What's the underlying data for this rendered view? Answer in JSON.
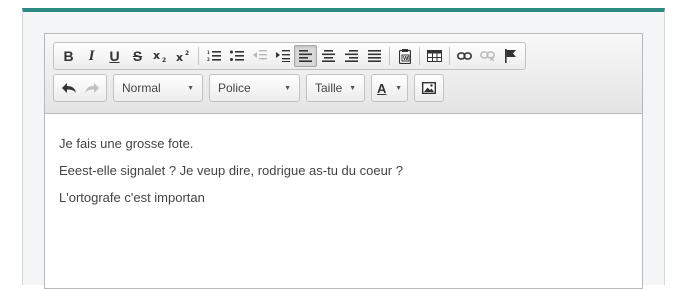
{
  "toolbar": {
    "buttons": {
      "bold": "B",
      "italic": "I",
      "underline": "U",
      "strike": "S"
    },
    "format_select": "Normal",
    "font_select": "Police",
    "size_select": "Taille",
    "text_color_label": "A",
    "active_alignment": "align-left",
    "colors": {
      "accent": "#2e8b84",
      "text": "#444444"
    }
  },
  "content": {
    "lines": [
      "Je fais une grosse fote.",
      "Eeest-elle signalet ? Je veup dire, rodrigue as-tu du coeur ?",
      "L'ortografe c'est importan"
    ]
  }
}
